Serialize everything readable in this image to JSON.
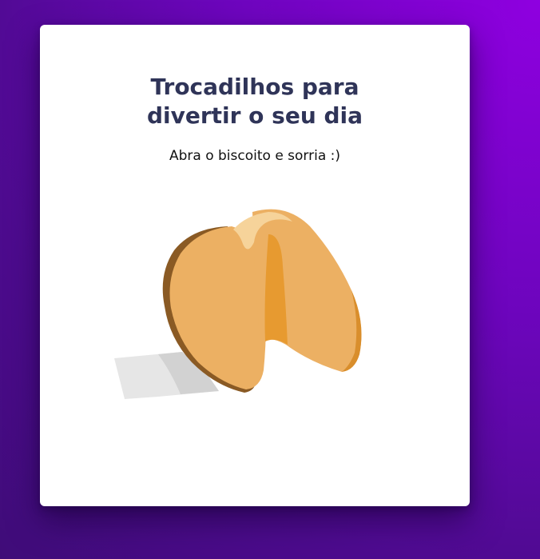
{
  "card": {
    "title_line1": "Trocadilhos para",
    "title_line2": "divertir o seu dia",
    "subtitle": "Abra o biscoito e sorria :)"
  },
  "cookie": {
    "icon": "fortune-cookie-icon",
    "colors": {
      "body": "#ecb063",
      "shadow": "#e79a30",
      "dark": "#8a5a24",
      "highlight": "#f6d39a",
      "paper_light": "#ececec",
      "paper_dark": "#d2d2d2"
    }
  },
  "colors": {
    "background": "#6d05bd",
    "card": "#ffffff",
    "title": "#2f3458"
  }
}
